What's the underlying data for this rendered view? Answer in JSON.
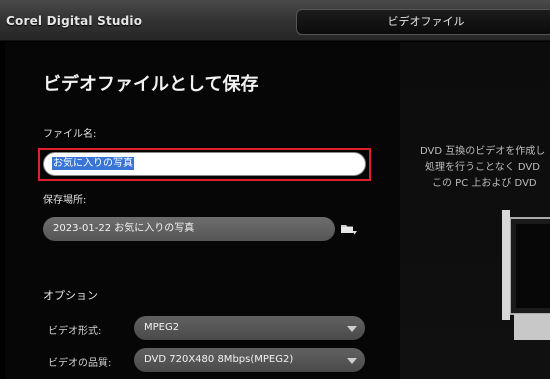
{
  "app": {
    "title": "Corel Digital Studio",
    "active_tab": "ビデオファイル"
  },
  "page": {
    "title": "ビデオファイルとして保存"
  },
  "filename": {
    "label": "ファイル名:",
    "value": "お気に入りの写真"
  },
  "location": {
    "label": "保存場所:",
    "value": "2023-01-22 お気に入りの写真"
  },
  "options": {
    "label": "オプション",
    "video_format": {
      "label": "ビデオ形式:",
      "value": "MPEG2"
    },
    "video_quality": {
      "label": "ビデオの品質:",
      "value": "DVD 720X480 8Mbps(MPEG2)"
    }
  },
  "description": {
    "line1": "DVD 互換のビデオを作成し",
    "line2": "処理を行うことなく DVD",
    "line3": "この PC 上および DVD"
  },
  "colors": {
    "highlight_border": "#e0202a",
    "selection": "#3875d7"
  },
  "icons": {
    "folder": "folder-browse-icon",
    "dropdown": "chevron-down-icon"
  }
}
